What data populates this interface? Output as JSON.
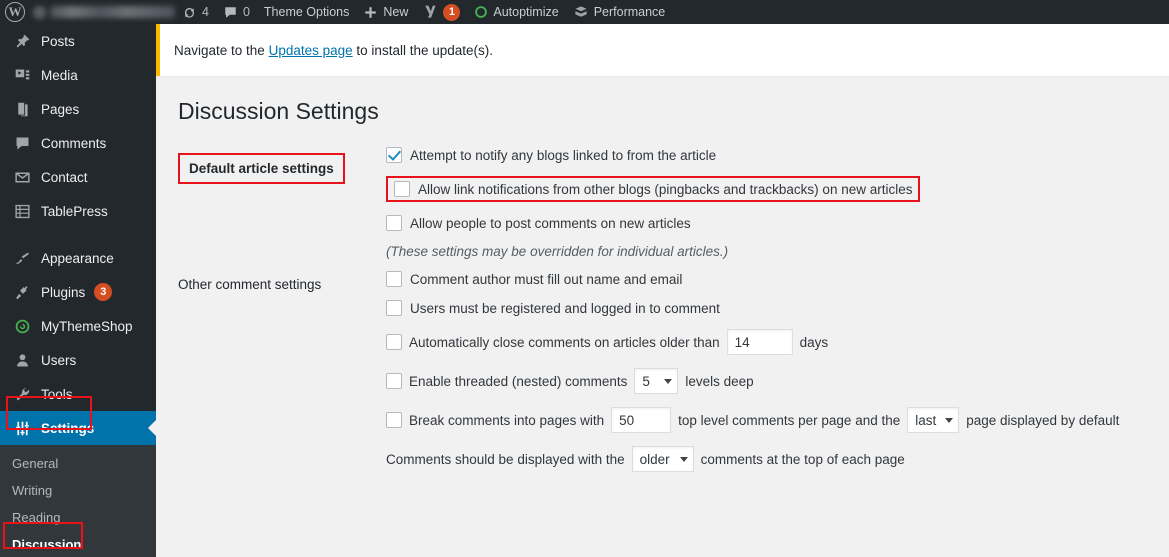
{
  "adminbar": {
    "wp_logo": "wordpress-logo",
    "site_name_redacted": true,
    "updates_count": "4",
    "comments_count": "0",
    "theme_options_label": "Theme Options",
    "new_label": "New",
    "yoast_badge": "1",
    "autoptimize_label": "Autoptimize",
    "performance_label": "Performance"
  },
  "sidebar": {
    "items": [
      {
        "label": "Posts",
        "icon": "pin-icon"
      },
      {
        "label": "Media",
        "icon": "media-icon"
      },
      {
        "label": "Pages",
        "icon": "pages-icon"
      },
      {
        "label": "Comments",
        "icon": "comment-bubble-icon"
      },
      {
        "label": "Contact",
        "icon": "envelope-icon"
      },
      {
        "label": "TablePress",
        "icon": "table-icon"
      },
      {
        "label": "Appearance",
        "icon": "paintbrush-icon"
      },
      {
        "label": "Plugins",
        "icon": "plug-icon",
        "badge": "3"
      },
      {
        "label": "MyThemeShop",
        "icon": "refresh-circle-icon"
      },
      {
        "label": "Users",
        "icon": "user-icon"
      },
      {
        "label": "Tools",
        "icon": "wrench-icon"
      },
      {
        "label": "Settings",
        "icon": "sliders-icon",
        "current": true
      }
    ],
    "submenu": [
      {
        "label": "General"
      },
      {
        "label": "Writing"
      },
      {
        "label": "Reading"
      },
      {
        "label": "Discussion",
        "current": true
      }
    ]
  },
  "notice": {
    "text_before": "Navigate to the",
    "link_label": "Updates page",
    "text_after": "to install the update(s)."
  },
  "page": {
    "title": "Discussion Settings"
  },
  "sections": {
    "default_article": {
      "label": "Default article settings",
      "options": [
        {
          "label": "Attempt to notify any blogs linked to from the article",
          "checked": true,
          "highlighted": false
        },
        {
          "label": "Allow link notifications from other blogs (pingbacks and trackbacks) on new articles",
          "checked": false,
          "highlighted": true
        },
        {
          "label": "Allow people to post comments on new articles",
          "checked": false,
          "highlighted": false
        }
      ],
      "note": "(These settings may be overridden for individual articles.)"
    },
    "other_comment": {
      "label": "Other comment settings",
      "opt_name_email": "Comment author must fill out name and email",
      "opt_registered": "Users must be registered and logged in to comment",
      "autoclose_before": "Automatically close comments on articles older than",
      "autoclose_days_value": "14",
      "autoclose_after": "days",
      "threaded_before": "Enable threaded (nested) comments",
      "threaded_levels_value": "5",
      "threaded_after": "levels deep",
      "break_before": "Break comments into pages with",
      "break_count_value": "50",
      "break_mid": "top level comments per page and the",
      "break_page_value": "last",
      "break_after": "page displayed by default",
      "display_before": "Comments should be displayed with the",
      "display_order_value": "older",
      "display_after": "comments at the top of each page"
    }
  },
  "colors": {
    "admin_dark": "#23282d",
    "submenu_dark": "#32373c",
    "accent_blue": "#0073aa",
    "notice_amber": "#ffb900",
    "annotation_red": "#e8131a",
    "badge_orange": "#d54e21",
    "checkbox_blue": "#1e8cbe"
  }
}
